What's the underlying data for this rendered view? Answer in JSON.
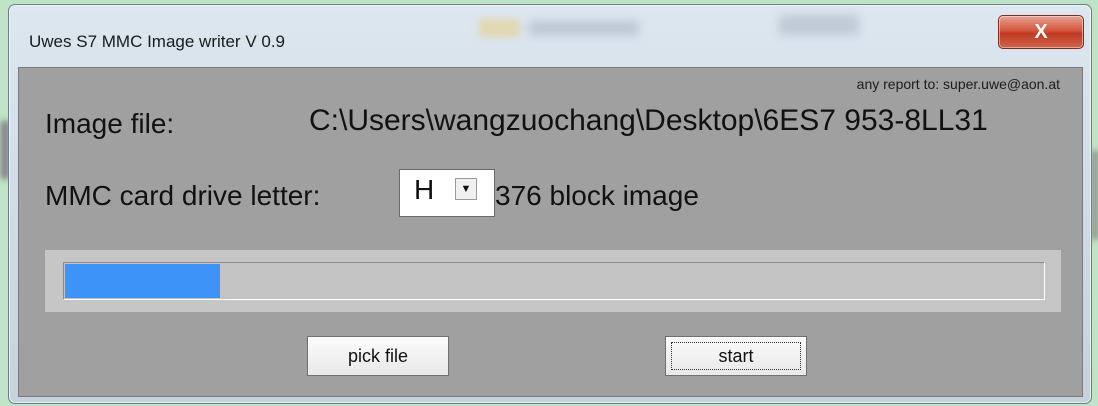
{
  "window": {
    "title": "Uwes S7 MMC Image writer V 0.9",
    "close_label": "X"
  },
  "main": {
    "report_text": "any report to: super.uwe@aon.at",
    "image_file_label": "Image file:",
    "image_file_path": "C:\\Users\\wangzuochang\\Desktop\\6ES7 953-8LL31",
    "drive_label": "MMC card drive letter:",
    "drive_value": "H",
    "block_text": "376 block image",
    "progress_fraction": 0.16
  },
  "buttons": {
    "pick_file": "pick file",
    "start": "start"
  },
  "colors": {
    "progress": "#3d93f7",
    "client_bg": "#a0a0a0",
    "close_button": "#c13a22"
  }
}
